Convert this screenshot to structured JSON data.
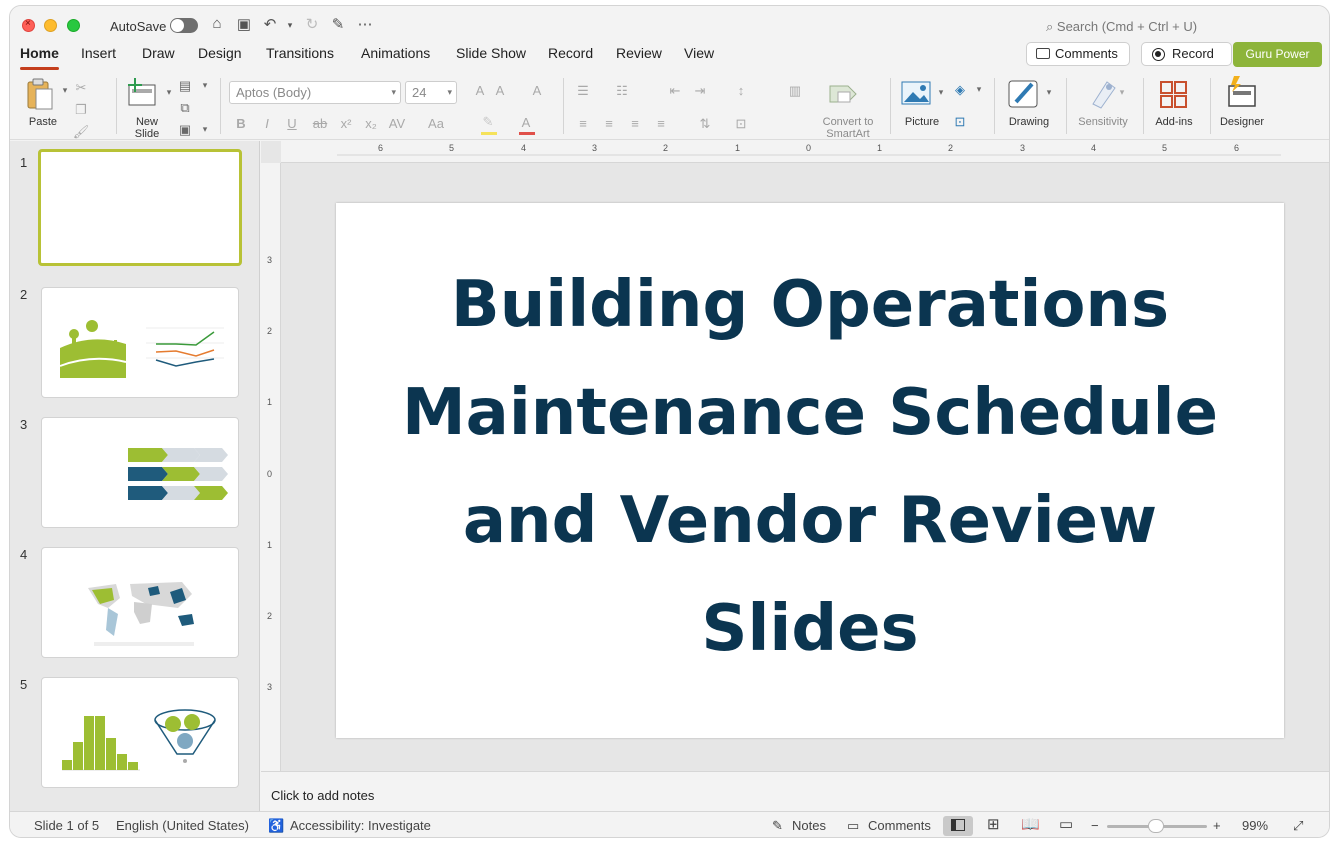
{
  "window": {
    "autosave_label": "AutoSave",
    "search_placeholder": "Search (Cmd + Ctrl + U)"
  },
  "tabs": [
    "Home",
    "Insert",
    "Draw",
    "Design",
    "Transitions",
    "Animations",
    "Slide Show",
    "Record",
    "Review",
    "View"
  ],
  "header_buttons": {
    "comments": "Comments",
    "record": "Record",
    "guru": "Guru Power"
  },
  "ribbon": {
    "paste": "Paste",
    "new_slide_1": "New",
    "new_slide_2": "Slide",
    "font_name": "Aptos (Body)",
    "font_size": "24",
    "smartart_1": "Convert to",
    "smartart_2": "SmartArt",
    "picture": "Picture",
    "drawing": "Drawing",
    "sensitivity": "Sensitivity",
    "addins": "Add-ins",
    "designer": "Designer",
    "bold": "B",
    "italic": "I",
    "underline": "U",
    "strike": "ab",
    "superscript": "x²",
    "subscript": "x₂",
    "spacing": "AV",
    "case": "Aa"
  },
  "thumbnails": [
    "1",
    "2",
    "3",
    "4",
    "5"
  ],
  "slide": {
    "title_lines": [
      "Building Operations",
      "Maintenance Schedule",
      "and Vendor Review",
      "Slides"
    ]
  },
  "rulers": {
    "top": [
      "6",
      "5",
      "4",
      "3",
      "2",
      "1",
      "0",
      "1",
      "2",
      "3",
      "4",
      "5",
      "6"
    ],
    "left": [
      "3",
      "2",
      "1",
      "0",
      "1",
      "2",
      "3"
    ]
  },
  "notes_placeholder": "Click to add notes",
  "status": {
    "slide_count": "Slide 1 of 5",
    "language": "English (United States)",
    "accessibility": "Accessibility: Investigate",
    "notes": "Notes",
    "comments": "Comments",
    "zoom": "99%"
  },
  "colors": {
    "accent": "#c43e1c",
    "brand_green": "#8db43a",
    "title_navy": "#0b3550",
    "thumb_green": "#9dbe33",
    "thumb_blue": "#1f5b7c"
  }
}
